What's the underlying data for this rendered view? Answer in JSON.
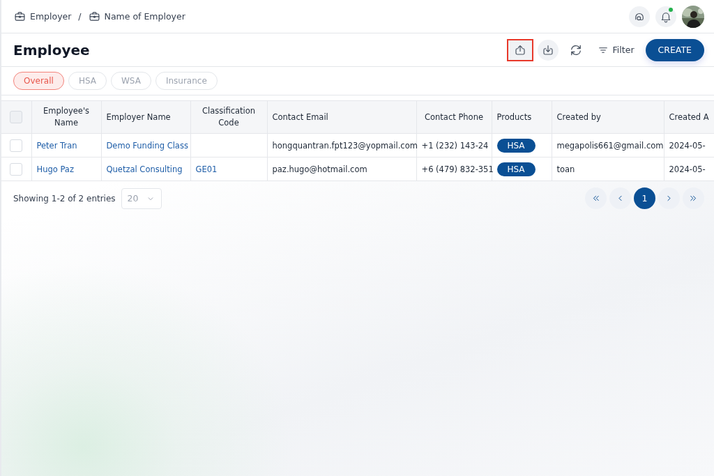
{
  "breadcrumb": [
    {
      "label": "Employer"
    },
    {
      "label": "Name of Employer"
    }
  ],
  "breadcrumb_separator": "/",
  "header_actions": [
    {
      "kind": "support"
    },
    {
      "kind": "notifications",
      "unread": true
    },
    {
      "kind": "picture"
    }
  ],
  "page_title": "Employee",
  "toolbar": [
    {
      "kind": "upload",
      "highlighted": true
    },
    {
      "kind": "download",
      "highlighted": false
    },
    {
      "kind": "refresh",
      "highlighted": false
    },
    {
      "kind": "filter",
      "label": "Filter",
      "highlighted": false
    },
    {
      "kind": "primary",
      "label": "CREATE",
      "highlighted": false
    }
  ],
  "tabs": [
    {
      "label": "Overall",
      "selected": true
    },
    {
      "label": "HSA",
      "selected": false
    },
    {
      "label": "WSA",
      "selected": false
    },
    {
      "label": "Insurance",
      "selected": false
    }
  ],
  "table": {
    "all_checked": false,
    "columns": [
      {
        "label": "Employee's Name"
      },
      {
        "label": "Employer Name"
      },
      {
        "label": "Classification Code"
      },
      {
        "label": "Contact Email"
      },
      {
        "label": "Contact Phone"
      },
      {
        "label": "Products"
      },
      {
        "label": "Created by"
      },
      {
        "label": "Created A"
      }
    ],
    "rows": [
      {
        "checked": false,
        "cells": [
          {
            "kind": "link",
            "text": "Peter Tran"
          },
          {
            "kind": "link",
            "text": "Demo Funding Class"
          },
          {
            "kind": "empty"
          },
          {
            "kind": "text",
            "text": "hongquantran.fpt123@yopmail.com"
          },
          {
            "kind": "text",
            "text": "+1 (232) 143-24"
          },
          {
            "kind": "tag",
            "text": "HSA"
          },
          {
            "kind": "text",
            "text": "megapolis661@gmail.com"
          },
          {
            "kind": "text",
            "text": "2024-05-"
          }
        ]
      },
      {
        "checked": false,
        "cells": [
          {
            "kind": "link",
            "text": "Hugo Paz"
          },
          {
            "kind": "link",
            "text": "Quetzal Consulting"
          },
          {
            "kind": "link",
            "text": "GE01"
          },
          {
            "kind": "text",
            "text": "paz.hugo@hotmail.com"
          },
          {
            "kind": "text",
            "text": "+6 (479) 832-351"
          },
          {
            "kind": "tag",
            "text": "HSA"
          },
          {
            "kind": "text",
            "text": "toan"
          },
          {
            "kind": "text",
            "text": "2024-05-"
          }
        ]
      }
    ]
  },
  "footer": {
    "summary": "Showing 1-2 of 2 entries",
    "page_size": "20",
    "pagination": [
      {
        "kind": "first"
      },
      {
        "kind": "prev"
      },
      {
        "kind": "page",
        "label": "1",
        "selected": true
      },
      {
        "kind": "next"
      },
      {
        "kind": "last"
      }
    ]
  }
}
